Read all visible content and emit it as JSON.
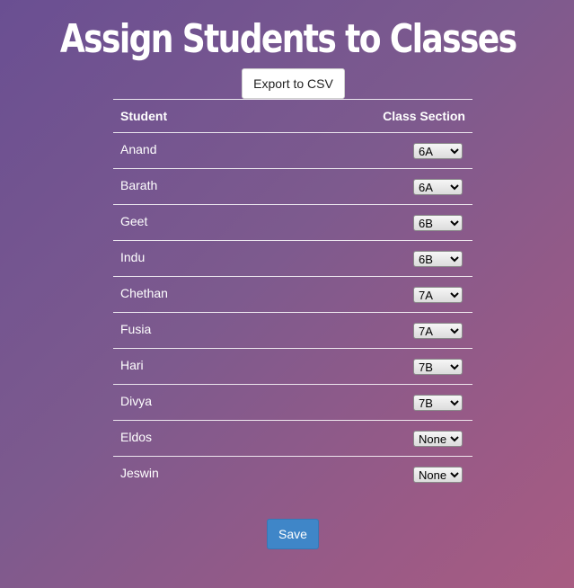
{
  "page": {
    "title": "Assign Students to Classes",
    "export_label": "Export to CSV",
    "save_label": "Save"
  },
  "table": {
    "headers": [
      "Student",
      "Class Section"
    ],
    "options": [
      "None",
      "6A",
      "6B",
      "7A",
      "7B"
    ],
    "rows": [
      {
        "student": "Anand",
        "section": "6A"
      },
      {
        "student": "Barath",
        "section": "6A"
      },
      {
        "student": "Geet",
        "section": "6B"
      },
      {
        "student": "Indu",
        "section": "6B"
      },
      {
        "student": "Chethan",
        "section": "7A"
      },
      {
        "student": "Fusia",
        "section": "7A"
      },
      {
        "student": "Hari",
        "section": "7B"
      },
      {
        "student": "Divya",
        "section": "7B"
      },
      {
        "student": "Eldos",
        "section": "None"
      },
      {
        "student": "Jeswin",
        "section": "None"
      }
    ]
  },
  "colors": {
    "background_start": "#6a4f92",
    "background_end": "#a85c82",
    "save_button": "#3f86c8"
  }
}
